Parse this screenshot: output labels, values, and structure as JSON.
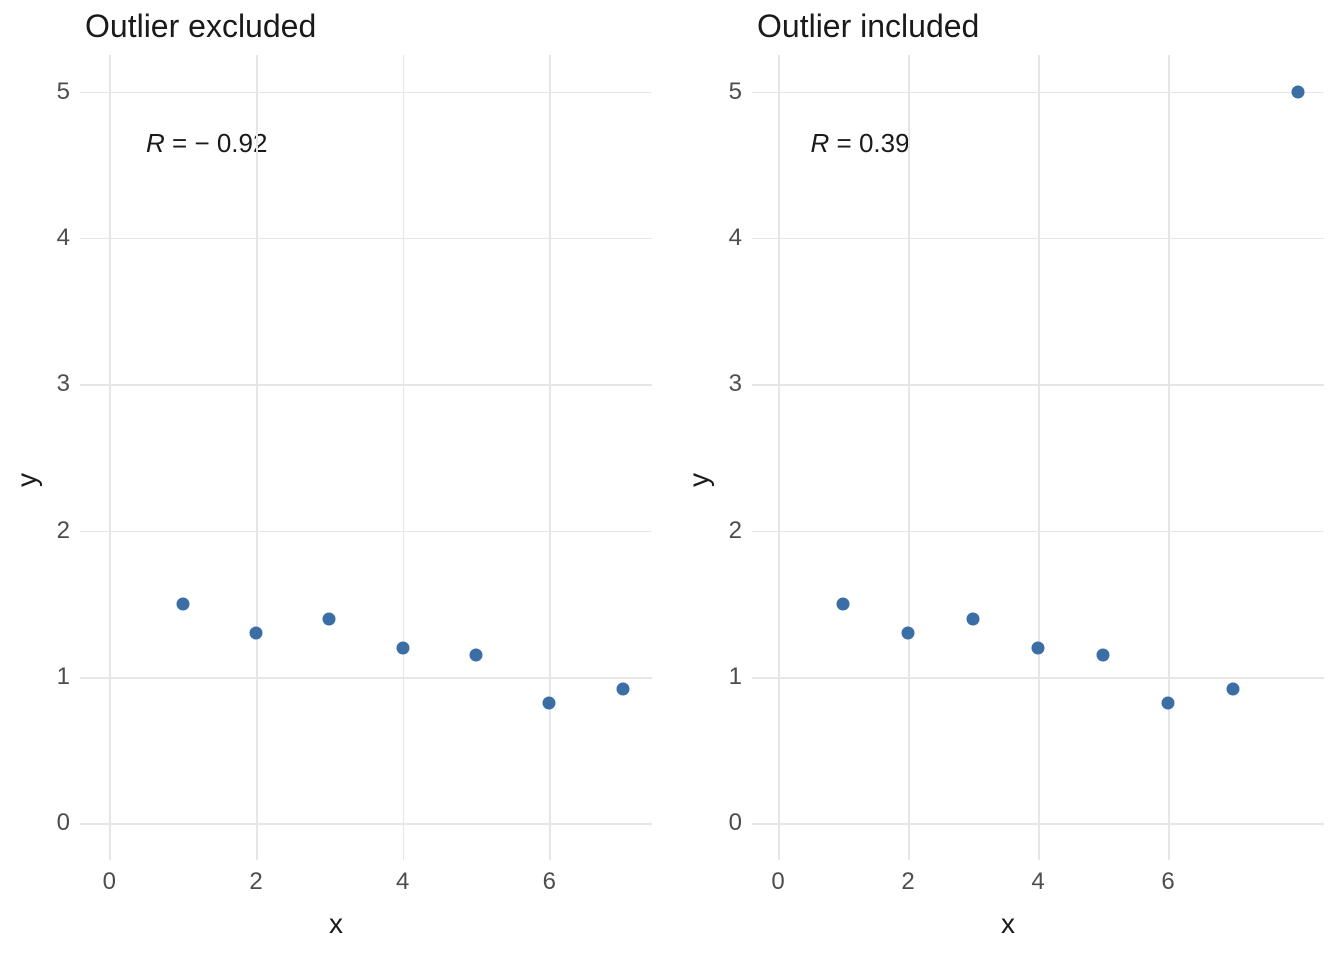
{
  "chart_data": [
    {
      "type": "scatter",
      "title": "Outlier excluded",
      "xlabel": "x",
      "ylabel": "y",
      "xlim": [
        -0.4,
        7.4
      ],
      "ylim": [
        -0.25,
        5.25
      ],
      "x_ticks": [
        0,
        2,
        4,
        6
      ],
      "y_ticks": [
        0,
        1,
        2,
        3,
        4,
        5
      ],
      "points": [
        {
          "x": 1,
          "y": 1.5
        },
        {
          "x": 2,
          "y": 1.3
        },
        {
          "x": 3,
          "y": 1.4
        },
        {
          "x": 4,
          "y": 1.2
        },
        {
          "x": 5,
          "y": 1.15
        },
        {
          "x": 6,
          "y": 0.82
        },
        {
          "x": 7,
          "y": 0.92
        }
      ],
      "annotation": {
        "label_prefix": "R",
        "value": "− 0.92",
        "raw": -0.92,
        "pos": {
          "x": 0.5,
          "y": 4.75
        }
      },
      "point_color": "#3a6ea5"
    },
    {
      "type": "scatter",
      "title": "Outlier included",
      "xlabel": "x",
      "ylabel": "y",
      "xlim": [
        -0.4,
        8.4
      ],
      "ylim": [
        -0.25,
        5.25
      ],
      "x_ticks": [
        0,
        2,
        4,
        6
      ],
      "y_ticks": [
        0,
        1,
        2,
        3,
        4,
        5
      ],
      "points": [
        {
          "x": 1,
          "y": 1.5
        },
        {
          "x": 2,
          "y": 1.3
        },
        {
          "x": 3,
          "y": 1.4
        },
        {
          "x": 4,
          "y": 1.2
        },
        {
          "x": 5,
          "y": 1.15
        },
        {
          "x": 6,
          "y": 0.82
        },
        {
          "x": 7,
          "y": 0.92
        },
        {
          "x": 8,
          "y": 5.0
        }
      ],
      "annotation": {
        "label_prefix": "R",
        "value": "0.39",
        "raw": 0.39,
        "pos": {
          "x": 0.5,
          "y": 4.75
        }
      },
      "point_color": "#3a6ea5"
    }
  ]
}
